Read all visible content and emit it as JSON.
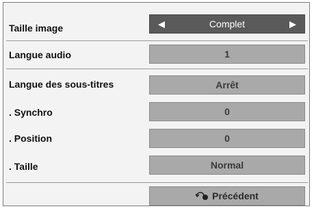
{
  "menu": {
    "rows": [
      {
        "label": "Taille image",
        "value": "Complet"
      },
      {
        "label": "Langue audio",
        "value": "1"
      },
      {
        "label": "Langue des sous-titres",
        "value": "Arrêt"
      },
      {
        "label": ". Synchro",
        "value": "0"
      },
      {
        "label": ". Position",
        "value": "0"
      },
      {
        "label": ". Taille",
        "value": "Normal"
      }
    ],
    "back_label": "Précédent",
    "icons": {
      "left": "arrow-left-icon",
      "right": "arrow-right-icon",
      "back": "return-icon"
    },
    "colors": {
      "selected": "#5a5a5a",
      "field": "#a9a9a9",
      "panel": "#f3f3f3"
    }
  }
}
